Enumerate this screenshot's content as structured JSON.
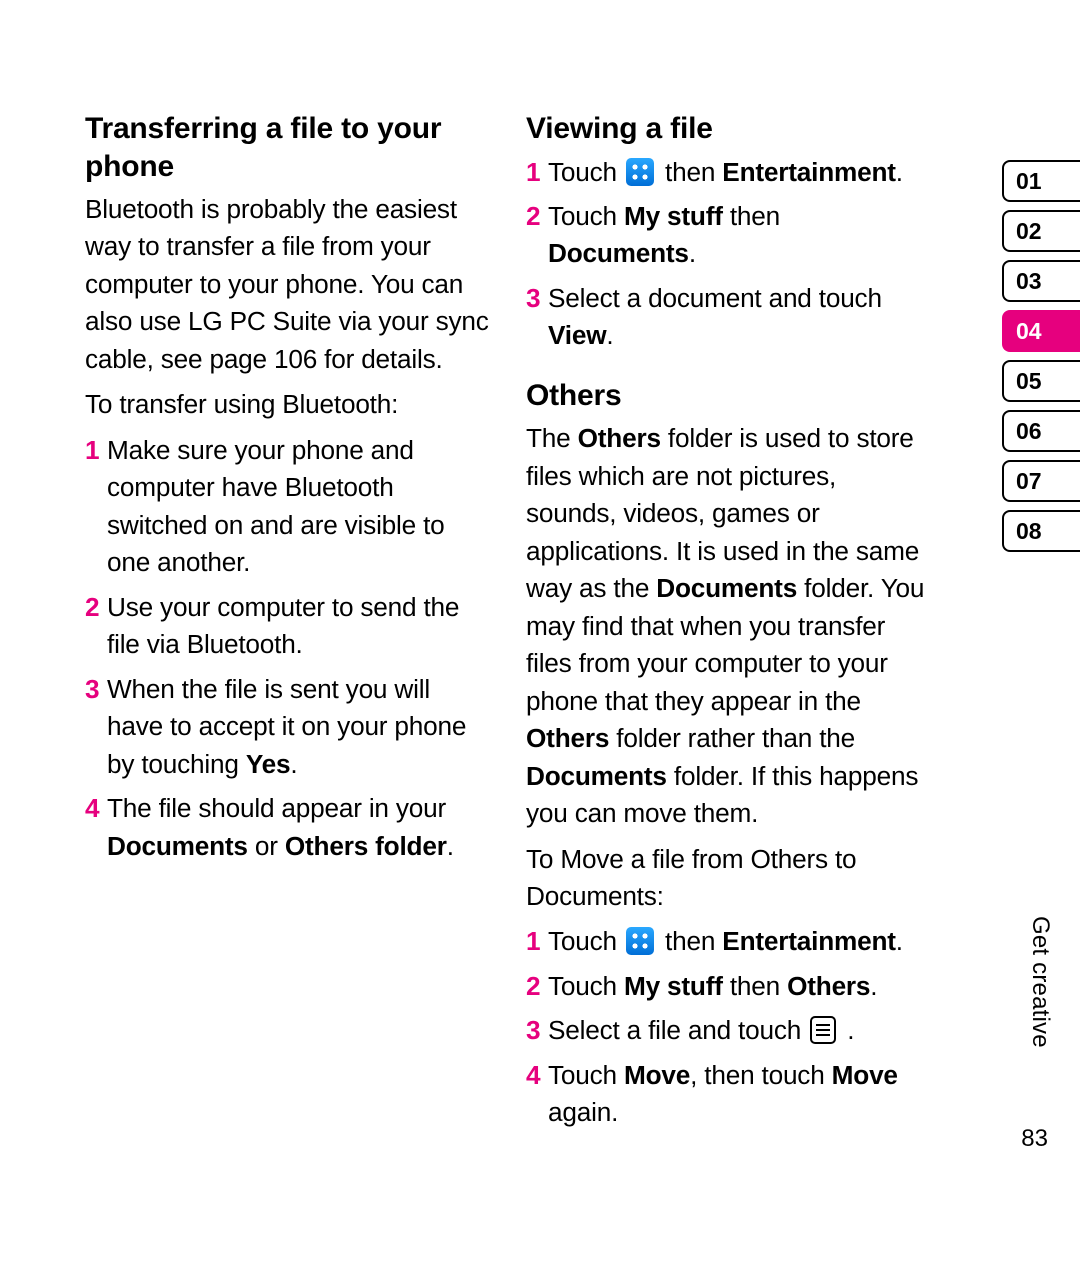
{
  "left": {
    "heading": "Transferring a file to your phone",
    "p1": "Bluetooth is probably the easiest way to transfer a file from your computer to your phone. You can also use LG PC Suite via your sync cable, see page 106 for details.",
    "p2": "To transfer using Bluetooth:",
    "steps": [
      {
        "n": "1",
        "text": "Make sure your phone and computer have Bluetooth switched on and are visible to one another."
      },
      {
        "n": "2",
        "text": "Use your computer to send the file via Bluetooth."
      },
      {
        "n": "3",
        "pre": "When the file is sent you will have to accept it on your phone by touching ",
        "b1": "Yes",
        "post": "."
      },
      {
        "n": "4",
        "pre": "The file should appear in your ",
        "b1": "Documents",
        "mid": " or ",
        "b2": "Others folder",
        "post": "."
      }
    ]
  },
  "right": {
    "h1": "Viewing a file",
    "view_steps": [
      {
        "n": "1",
        "pre": "Touch ",
        "icon": "apps",
        "mid": " then ",
        "b1": "Entertainment",
        "post": "."
      },
      {
        "n": "2",
        "pre": "Touch ",
        "b1": "My stuff",
        "mid": " then ",
        "b2": "Documents",
        "post": "."
      },
      {
        "n": "3",
        "pre": "Select a document and touch ",
        "b1": "View",
        "post": "."
      }
    ],
    "h2": "Others",
    "others_p_pre": "The ",
    "others_b1": "Others",
    "others_p_mid1": " folder is used to store files which are not pictures, sounds, videos, games or applications. It is used in the same way as the ",
    "others_b2": "Documents",
    "others_p_mid2": " folder. You may find that when you transfer files from your computer to your phone that they appear in the ",
    "others_b3": "Others",
    "others_p_mid3": " folder rather than the ",
    "others_b4": "Documents",
    "others_p_end": " folder. If this happens you can move them.",
    "move_intro": "To Move a file from Others to Documents:",
    "move_steps": [
      {
        "n": "1",
        "pre": "Touch ",
        "icon": "apps",
        "mid": " then ",
        "b1": "Entertainment",
        "post": "."
      },
      {
        "n": "2",
        "pre": "Touch ",
        "b1": "My stuff",
        "mid": " then ",
        "b2": "Others",
        "post": "."
      },
      {
        "n": "3",
        "pre": "Select a file and touch ",
        "icon": "menu",
        "post": " ."
      },
      {
        "n": "4",
        "pre": "Touch ",
        "b1": "Move",
        "mid": ", then touch ",
        "b2": "Move",
        "post": " again."
      }
    ]
  },
  "tabs": [
    "01",
    "02",
    "03",
    "04",
    "05",
    "06",
    "07",
    "08"
  ],
  "active_tab_index": 3,
  "side_label": "Get creative",
  "page_number": "83"
}
